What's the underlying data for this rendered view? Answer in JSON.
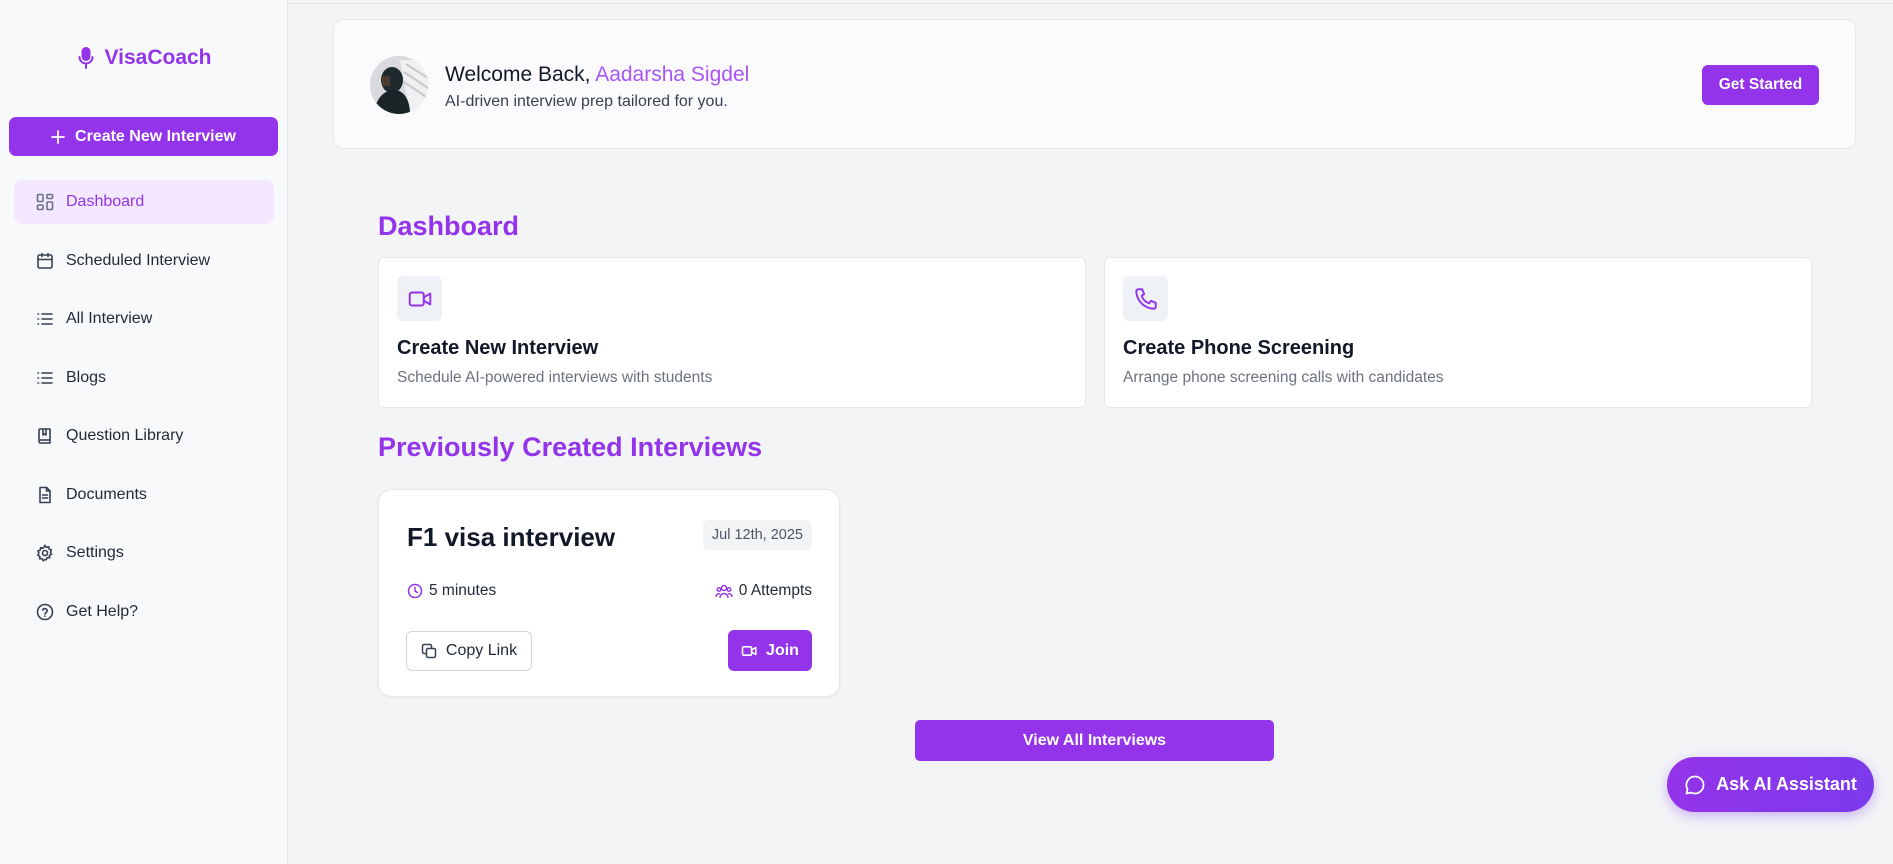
{
  "sidebar": {
    "logo_text": "VisaCoach",
    "create_button_label": "Create New Interview",
    "items": [
      {
        "label": "Dashboard",
        "icon": "dashboard-icon",
        "active": true
      },
      {
        "label": "Scheduled Interview",
        "icon": "calendar-icon"
      },
      {
        "label": "All Interview",
        "icon": "list-icon"
      },
      {
        "label": "Blogs",
        "icon": "list-icon"
      },
      {
        "label": "Question Library",
        "icon": "book-icon"
      },
      {
        "label": "Documents",
        "icon": "document-icon"
      },
      {
        "label": "Settings",
        "icon": "gear-icon"
      },
      {
        "label": "Get Help?",
        "icon": "help-icon"
      }
    ]
  },
  "welcome": {
    "greeting": "Welcome Back,",
    "user_name": "Aadarsha Sigdel",
    "subtitle": "AI-driven interview prep tailored for you.",
    "cta_label": "Get Started"
  },
  "dashboard": {
    "heading": "Dashboard",
    "cards": [
      {
        "title": "Create New Interview",
        "subtitle": "Schedule AI-powered interviews with students",
        "icon": "video-icon"
      },
      {
        "title": "Create Phone Screening",
        "subtitle": "Arrange phone screening calls with candidates",
        "icon": "phone-icon"
      }
    ]
  },
  "previous": {
    "heading": "Previously Created Interviews",
    "interviews": [
      {
        "title": "F1 visa interview",
        "date": "Jul 12th, 2025",
        "duration": "5 minutes",
        "attempts": "0 Attempts",
        "copy_label": "Copy Link",
        "join_label": "Join"
      }
    ],
    "view_all_label": "View All Interviews"
  },
  "assistant_label": "Ask AI Assistant",
  "colors": {
    "accent": "#9333ea",
    "accent_light": "#f3e8ff",
    "background": "#f3f4f6"
  }
}
